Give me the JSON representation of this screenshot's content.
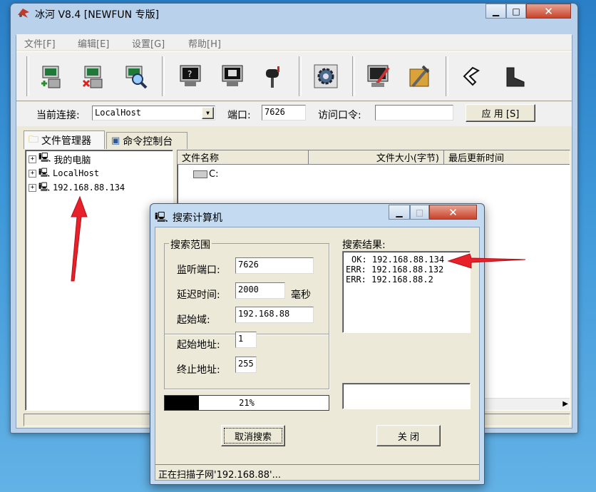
{
  "window": {
    "title": "冰河 V8.4 [NEWFUN 专版]"
  },
  "menu": [
    "文件[F]",
    "编辑[E]",
    "设置[G]",
    "帮助[H]"
  ],
  "toolbar": {
    "icons": [
      "add-computer-icon",
      "delete-computer-icon",
      "search-computer-icon",
      "screen-info-icon",
      "screen-capture-icon",
      "mailbox-icon",
      "config-gear-icon",
      "terminal-icon",
      "tools-icon",
      "back-icon",
      "boot-icon"
    ]
  },
  "connection": {
    "label": "当前连接:",
    "value": "LocalHost",
    "port_label": "端口:",
    "port_value": "7626",
    "password_label": "访问口令:",
    "password_value": "",
    "apply_label": "应 用 [S]"
  },
  "tabs": [
    "文件管理器",
    "命令控制台"
  ],
  "tree": [
    "我的电脑",
    "LocalHost",
    "192.168.88.134"
  ],
  "file_list": {
    "columns": [
      "文件名称",
      "文件大小(字节)",
      "最后更新时间"
    ],
    "items": [
      "C:"
    ]
  },
  "dialog": {
    "title": "搜索计算机",
    "range_group": "搜索范围",
    "port_label": "监听端口:",
    "port_value": "7626",
    "delay_label": "延迟时间:",
    "delay_value": "2000",
    "delay_unit": "毫秒",
    "domain_label": "起始域:",
    "domain_value": "192.168.88",
    "start_label": "起始地址:",
    "start_value": "1",
    "end_label": "终止地址:",
    "end_value": "255",
    "results_label": "搜索结果:",
    "results": [
      "OK: 192.168.88.134",
      "ERR: 192.168.88.132",
      "ERR: 192.168.88.2"
    ],
    "progress": 0.21,
    "progress_text": "21%",
    "cancel_label": "取消搜索",
    "close_label": "关 闭",
    "status": "正在扫描子网'192.168.88'..."
  },
  "colors": {
    "arrow": "#e8202a",
    "progress_fill": "#000000",
    "title_bar": "#b9d1ea"
  }
}
